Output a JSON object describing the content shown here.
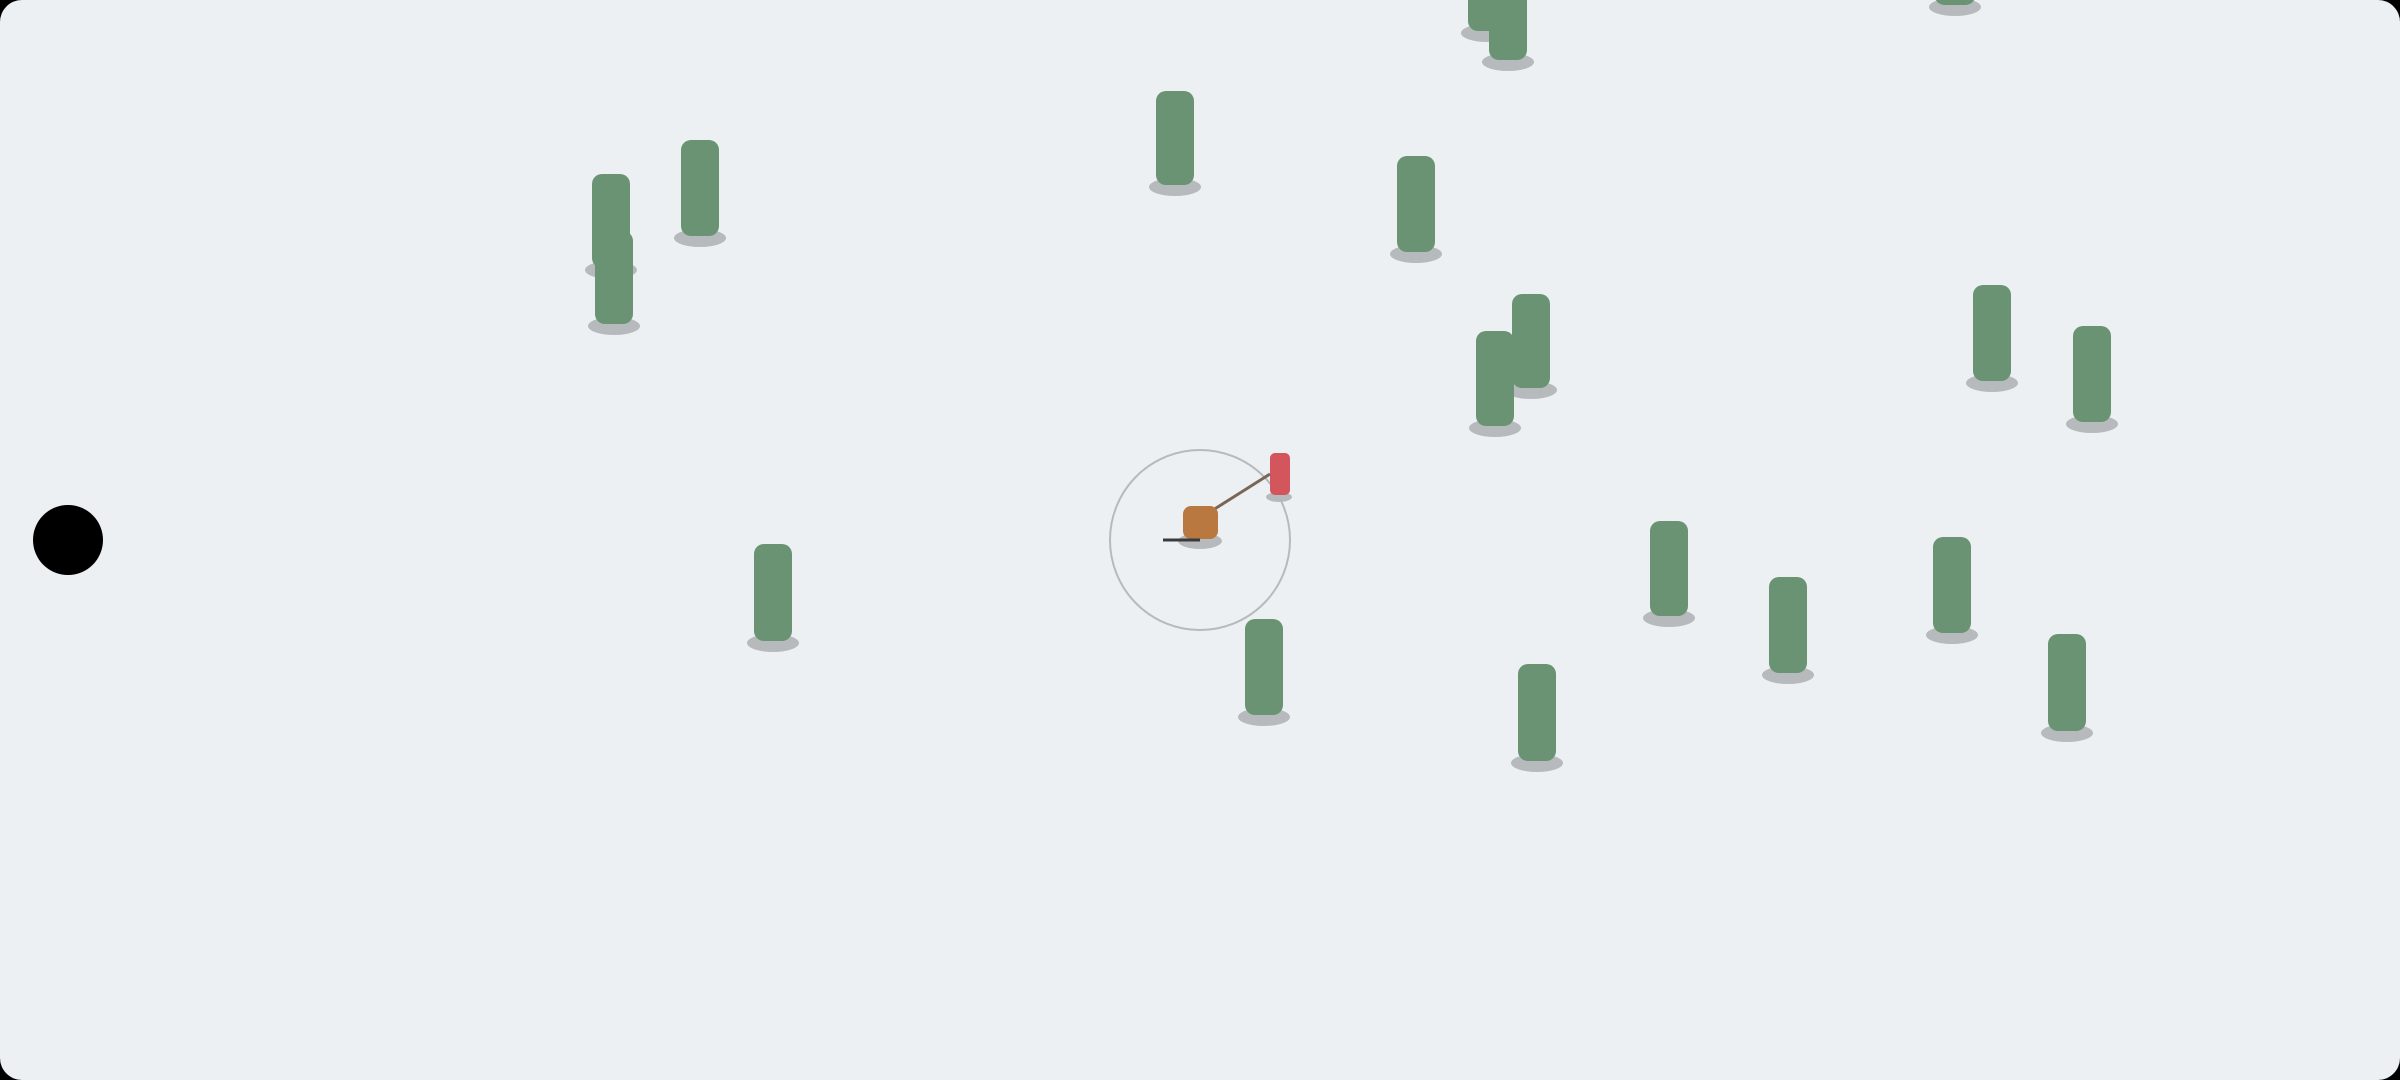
{
  "colors": {
    "background": "#edf0f3",
    "tree": "#6a9373",
    "shadow": "#b7babd",
    "player": "#b87840",
    "target": "#d2565c",
    "aim_line": "#7a6656",
    "range_ring": "#b7babd",
    "weapon": "#3a3a3a",
    "joystick": "#000000"
  },
  "icons": {
    "player": "player-icon",
    "target": "enemy-icon",
    "obstacle": "tree-icon",
    "joystick": "joystick-icon"
  },
  "player": {
    "aim": "target",
    "has_range_ring": true
  },
  "enemy_count": 1,
  "tree_count": 21
}
